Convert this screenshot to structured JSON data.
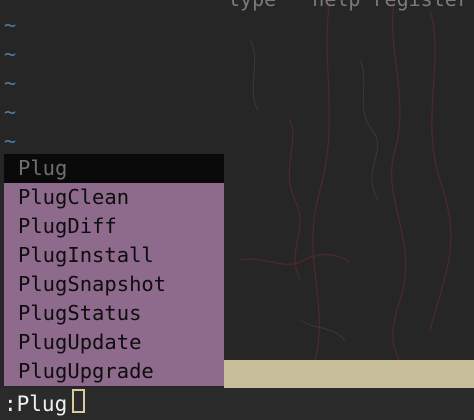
{
  "editor": {
    "top_text": "type   help register",
    "tilde_char": "~"
  },
  "completion_menu": {
    "items": [
      "Plug",
      "PlugClean",
      "PlugDiff",
      "PlugInstall",
      "PlugSnapshot",
      "PlugStatus",
      "PlugUpdate",
      "PlugUpgrade"
    ],
    "selected_index": 0
  },
  "command_line": {
    "text": ":Plug"
  },
  "colors": {
    "background": "#262626",
    "tilde": "#4d7ea8",
    "menu_bg": "#8e6a8d",
    "menu_selected_bg": "#0a0a0a",
    "cursor": "#d8cc9a",
    "statusbar": "#c8bd99"
  }
}
